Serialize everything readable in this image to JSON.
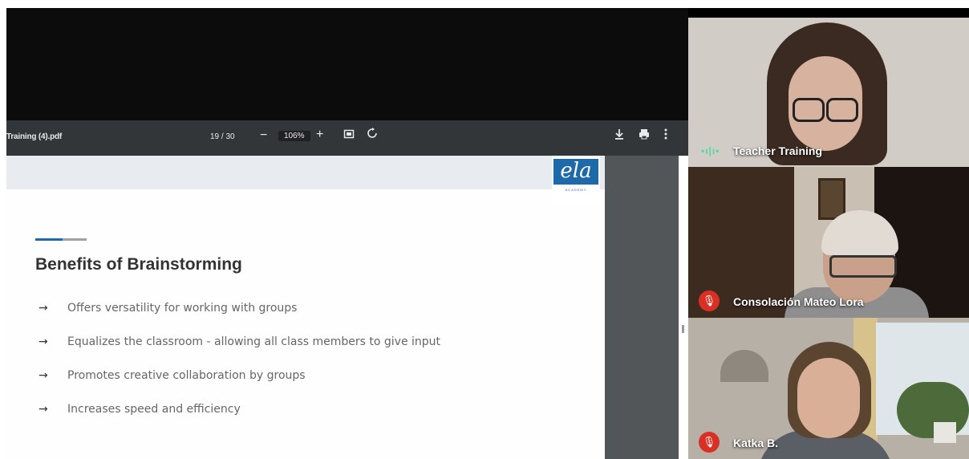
{
  "pdf_toolbar": {
    "file_title": "Training (4).pdf",
    "page_indicator": "19 / 30",
    "zoom_level": "106%",
    "zoom_out_symbol": "−",
    "zoom_in_symbol": "+",
    "icons": [
      "minus-icon",
      "plus-icon",
      "fit-page-icon",
      "rotate-icon",
      "download-icon",
      "print-icon",
      "more-vert-icon"
    ]
  },
  "slide": {
    "logo_text": "ela",
    "logo_subtext": "ACADEMY",
    "title": "Benefits of Brainstorming",
    "bullet_symbol": "→",
    "bullets": [
      "Offers versatility for working with groups",
      "Equalizes the classroom - allowing all class members to give input",
      "Promotes creative collaboration by groups",
      "Increases speed and efficiency"
    ],
    "colors": {
      "accent": "#1e6aa9",
      "title": "#333333",
      "bullet": "#666666"
    }
  },
  "participants": [
    {
      "name": "Teacher Training",
      "status_icon": "speaking-indicator-icon",
      "talk_glyph": "•ı|ı•"
    },
    {
      "name": "Consolación Mateo Lora",
      "status_icon": "mic-muted-icon",
      "mic_glyph": "🎙"
    },
    {
      "name": "Katka B.",
      "status_icon": "mic-muted-icon",
      "mic_glyph": "🎙"
    }
  ],
  "colors": {
    "muted": "#d93025",
    "speaking": "#4fd8a8",
    "toolbar": "#323639"
  }
}
